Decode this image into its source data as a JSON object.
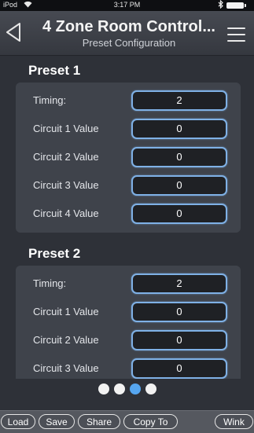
{
  "status_bar": {
    "carrier": "iPod",
    "wifi_icon": "wifi-icon",
    "time": "3:17 PM",
    "bluetooth_icon": "bluetooth-icon",
    "battery_icon": "battery-icon"
  },
  "header": {
    "back_icon": "back-triangle-icon",
    "title": "4 Zone Room Control...",
    "subtitle": "Preset Configuration",
    "menu_icon": "hamburger-menu-icon"
  },
  "presets": [
    {
      "title": "Preset 1",
      "rows": [
        {
          "label": "Timing:",
          "value": "2"
        },
        {
          "label": "Circuit 1 Value",
          "value": "0"
        },
        {
          "label": "Circuit 2 Value",
          "value": "0"
        },
        {
          "label": "Circuit 3 Value",
          "value": "0"
        },
        {
          "label": "Circuit 4 Value",
          "value": "0"
        }
      ]
    },
    {
      "title": "Preset 2",
      "rows": [
        {
          "label": "Timing:",
          "value": "2"
        },
        {
          "label": "Circuit 1 Value",
          "value": "0"
        },
        {
          "label": "Circuit 2 Value",
          "value": "0"
        },
        {
          "label": "Circuit 3 Value",
          "value": "0"
        }
      ]
    }
  ],
  "pager": {
    "count": 4,
    "active_index": 2,
    "active_color": "#56a6f0"
  },
  "toolbar": {
    "load": "Load",
    "save": "Save",
    "share": "Share",
    "copy_to": "Copy To",
    "wink": "Wink"
  }
}
